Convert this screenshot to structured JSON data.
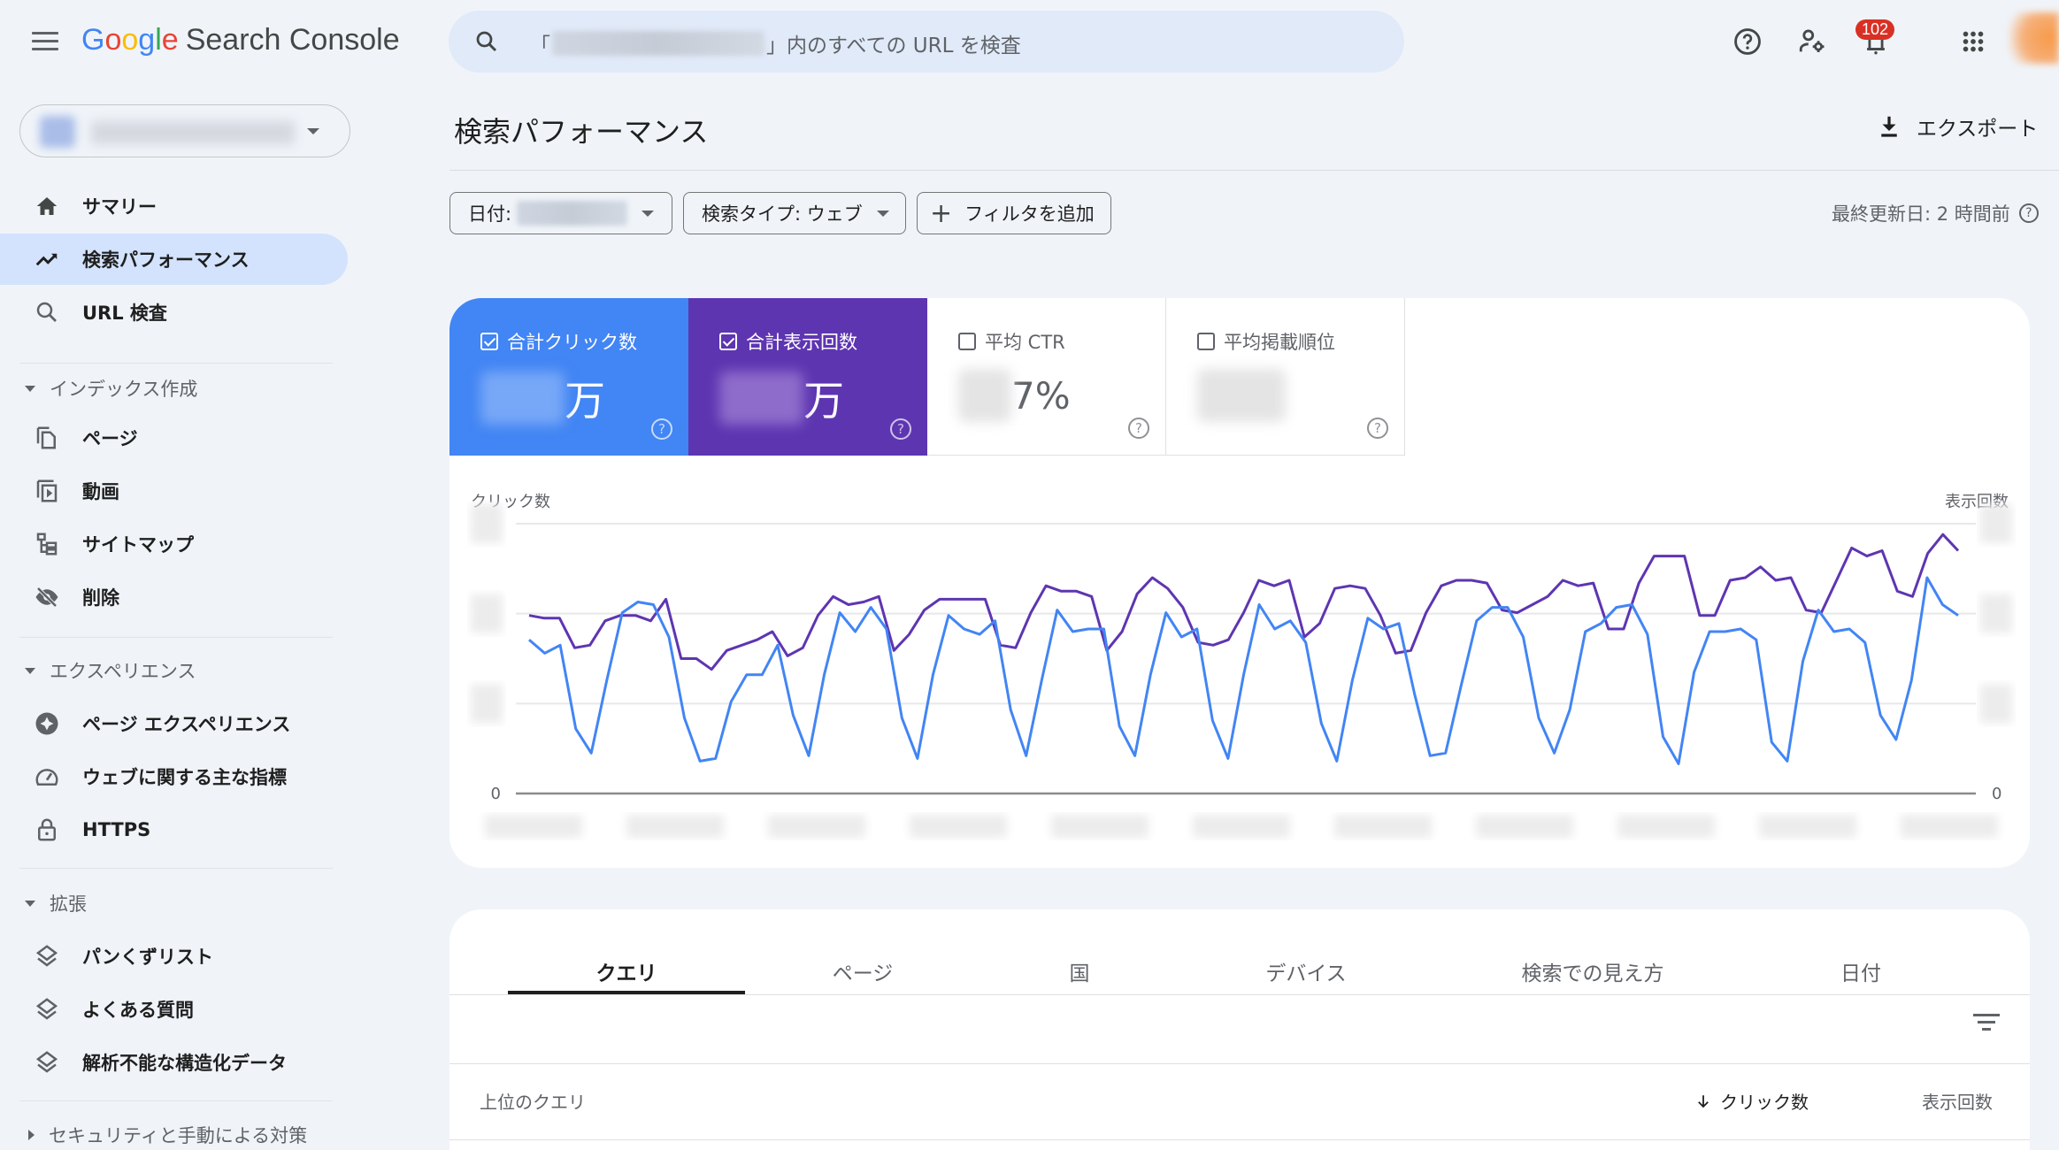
{
  "app": {
    "logo_google": [
      "G",
      "o",
      "o",
      "g",
      "l",
      "e"
    ],
    "logo_product": "Search Console"
  },
  "search": {
    "prefix": "「",
    "suffix": "」内のすべての URL を検査"
  },
  "top_icons": [
    "help-icon",
    "account-settings-icon",
    "notifications-icon",
    "apps-grid-icon",
    "avatar"
  ],
  "notifications_count": "102",
  "sidebar": {
    "items": [
      {
        "label": "サマリー",
        "icon": "home-icon",
        "active": false
      },
      {
        "label": "検索パフォーマンス",
        "icon": "trending-up-icon",
        "active": true
      },
      {
        "label": "URL 検査",
        "icon": "search-icon",
        "active": false
      }
    ],
    "sections": [
      {
        "title": "インデックス作成",
        "expanded": true,
        "items": [
          {
            "label": "ページ",
            "icon": "pages-icon"
          },
          {
            "label": "動画",
            "icon": "video-icon"
          },
          {
            "label": "サイトマップ",
            "icon": "sitemap-icon"
          },
          {
            "label": "削除",
            "icon": "visibility-off-icon"
          }
        ]
      },
      {
        "title": "エクスペリエンス",
        "expanded": true,
        "items": [
          {
            "label": "ページ エクスペリエンス",
            "icon": "page-experience-icon"
          },
          {
            "label": "ウェブに関する主な指標",
            "icon": "speed-icon"
          },
          {
            "label": "HTTPS",
            "icon": "lock-icon"
          }
        ]
      },
      {
        "title": "拡張",
        "expanded": true,
        "items": [
          {
            "label": "パンくずリスト",
            "icon": "layers-icon"
          },
          {
            "label": "よくある質問",
            "icon": "layers-icon"
          },
          {
            "label": "解析不能な構造化データ",
            "icon": "layers-icon"
          }
        ]
      },
      {
        "title": "セキュリティと手動による対策",
        "expanded": false,
        "items": []
      }
    ]
  },
  "header": {
    "title": "検索パフォーマンス",
    "export_label": "エクスポート"
  },
  "filters": {
    "date_label": "日付:",
    "search_type_label": "検索タイプ: ウェブ",
    "add_filter_label": "フィルタを追加",
    "last_updated": "最終更新日: 2 時間前"
  },
  "metrics": [
    {
      "label": "合計クリック数",
      "checked": true,
      "value_suffix": "万",
      "color": "#4285f4"
    },
    {
      "label": "合計表示回数",
      "checked": true,
      "value_suffix": "万",
      "color": "#5e35b1"
    },
    {
      "label": "平均 CTR",
      "checked": false,
      "value_suffix": "7%"
    },
    {
      "label": "平均掲載順位",
      "checked": false,
      "value_suffix": ""
    }
  ],
  "chart_data": {
    "type": "line",
    "title": "",
    "ylabel_left": "クリック数",
    "ylabel_right": "表示回数",
    "y_min_label_left": "0",
    "y_min_label_right": "0",
    "grid": true,
    "ylim": [
      0,
      100
    ],
    "note": "Axis tick values and x date labels are blurred in the screenshot; values are normalized to the top gridline (=100).",
    "series": [
      {
        "name": "クリック数",
        "color": "#4285f4",
        "axis": "left",
        "values": [
          57,
          52,
          55,
          24,
          15,
          42,
          67,
          71,
          70,
          58,
          28,
          12,
          13,
          34,
          44,
          44,
          55,
          29,
          14,
          44,
          67,
          60,
          69,
          61,
          28,
          13,
          44,
          66,
          61,
          59,
          64,
          31,
          14,
          42,
          68,
          60,
          61,
          61,
          25,
          14,
          44,
          67,
          58,
          61,
          27,
          13,
          44,
          70,
          61,
          64,
          56,
          26,
          12,
          42,
          65,
          61,
          63,
          37,
          14,
          15,
          40,
          64,
          69,
          69,
          58,
          28,
          15,
          31,
          60,
          63,
          69,
          70,
          59,
          21,
          11,
          45,
          60,
          60,
          61,
          57,
          19,
          12,
          49,
          68,
          60,
          61,
          56,
          29,
          20,
          42,
          80,
          70,
          66
        ]
      },
      {
        "name": "表示回数",
        "color": "#5e35b1",
        "axis": "right",
        "values": [
          66,
          65,
          65,
          54,
          55,
          64,
          66,
          66,
          64,
          72,
          50,
          50,
          46,
          53,
          55,
          57,
          60,
          51,
          54,
          66,
          73,
          70,
          71,
          73,
          53,
          59,
          68,
          72,
          72,
          72,
          72,
          55,
          54,
          67,
          77,
          75,
          75,
          73,
          53,
          60,
          74,
          80,
          76,
          69,
          56,
          55,
          57,
          67,
          79,
          77,
          79,
          58,
          63,
          76,
          77,
          76,
          66,
          52,
          53,
          67,
          77,
          79,
          79,
          78,
          68,
          67,
          70,
          73,
          79,
          77,
          78,
          61,
          61,
          78,
          88,
          88,
          88,
          66,
          66,
          79,
          80,
          84,
          79,
          80,
          68,
          67,
          79,
          91,
          88,
          90,
          75,
          73,
          89,
          96,
          90
        ]
      }
    ]
  },
  "table": {
    "tabs": [
      {
        "label": "クエリ",
        "active": true
      },
      {
        "label": "ページ",
        "active": false
      },
      {
        "label": "国",
        "active": false
      },
      {
        "label": "デバイス",
        "active": false
      },
      {
        "label": "検索での見え方",
        "active": false
      },
      {
        "label": "日付",
        "active": false
      }
    ],
    "columns": {
      "query": "上位のクエリ",
      "clicks": "クリック数",
      "impressions": "表示回数"
    },
    "sort": "clicks-desc"
  }
}
